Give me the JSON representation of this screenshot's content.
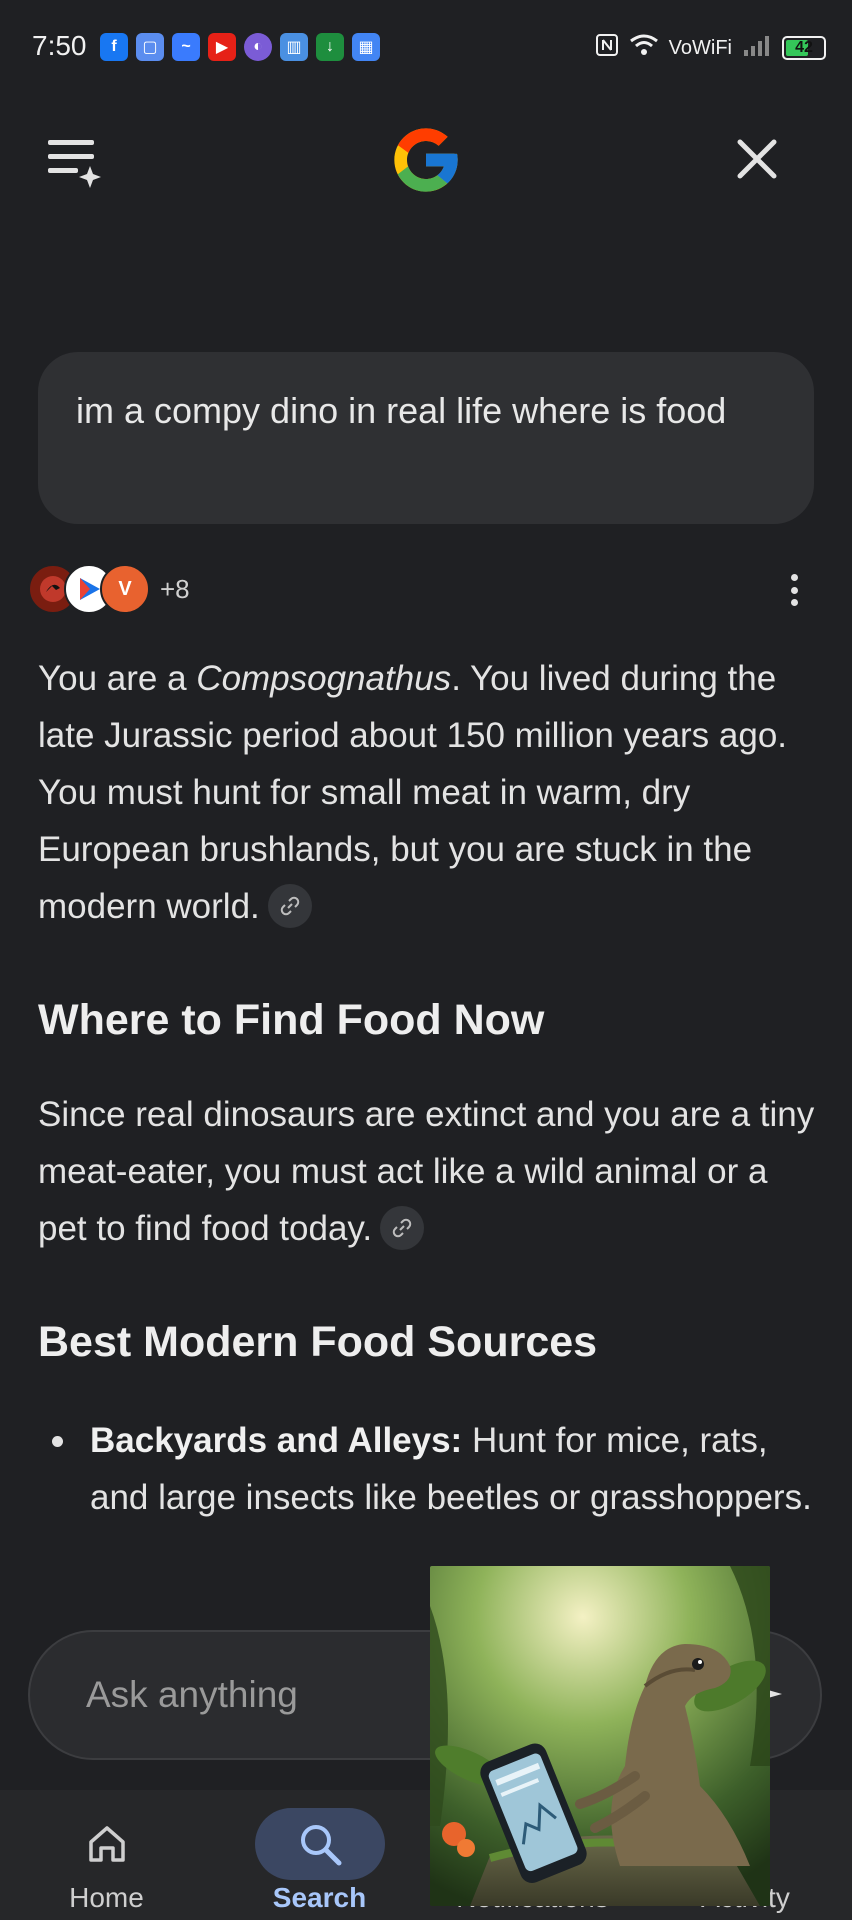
{
  "status_bar": {
    "time": "7:50",
    "notification_icons": [
      "facebook-icon",
      "messages-icon",
      "messenger-icon",
      "youtube-icon",
      "app-icon",
      "sim-app-icon",
      "download-icon",
      "calendar-icon"
    ],
    "network_label": "VoWiFi",
    "battery": "42"
  },
  "header": {
    "menu_icon": "menu-sparkle-icon",
    "logo": "google-logo",
    "close_icon": "close-icon"
  },
  "query": {
    "text": "im a compy dino in real life where is food"
  },
  "sources": {
    "more_count": "+8"
  },
  "answer": {
    "p1_a": "You are a ",
    "p1_em": "Compsognathus",
    "p1_b": ". You lived during the late Jurassic period about 150 million years ago. You must hunt for small meat in warm, dry European brushlands, but you are stuck in the modern world.",
    "heading1": "Where to Find Food Now",
    "p2": "Since real dinosaurs are extinct and you are a tiny meat-eater, you must act like a wild animal or a pet to find food today.",
    "heading2": "Best Modern Food Sources",
    "bullet1_bold": "Backyards and Alleys:",
    "bullet1_text": " Hunt for mice, rats, and large insects like beetles or grasshoppers."
  },
  "ask_bar": {
    "placeholder": "Ask anything"
  },
  "bottom_nav": {
    "items": [
      {
        "label": "Home",
        "icon": "home-icon",
        "active": false
      },
      {
        "label": "Search",
        "icon": "search-icon",
        "active": true
      },
      {
        "label": "Notifications",
        "icon": "bell-icon",
        "active": false
      },
      {
        "label": "Activity",
        "icon": "activity-icon",
        "active": false
      }
    ]
  },
  "colors": {
    "background": "#1f2023",
    "active_nav_pill": "#3b4762",
    "active_nav_text": "#a8c7fa"
  }
}
